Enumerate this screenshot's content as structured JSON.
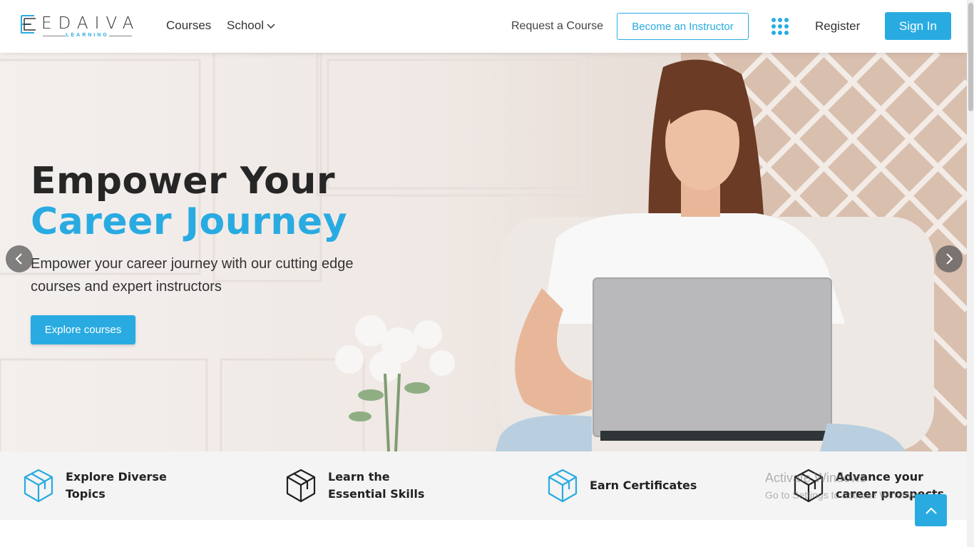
{
  "brand": {
    "name": "EDAIVA",
    "tagline": "LEARNING",
    "accent_color": "#29abe2"
  },
  "nav": {
    "courses": "Courses",
    "school": "School",
    "request_course": "Request a Course",
    "become_instructor": "Become an Instructor",
    "apps_icon": "grid-dots-icon",
    "register": "Register",
    "sign_in": "Sign In"
  },
  "hero": {
    "title_line1": "Empower Your",
    "title_line2": "Career Journey",
    "subtitle": "Empower your career journey with our cutting edge courses and expert instructors",
    "cta": "Explore courses",
    "prev_icon": "chevron-left-icon",
    "next_icon": "chevron-right-icon"
  },
  "features": [
    {
      "label": "Explore Diverse Topics",
      "icon": "cube-icon",
      "icon_color": "#29abe2"
    },
    {
      "label": "Learn the Essential Skills",
      "icon": "cube-icon",
      "icon_color": "#222222"
    },
    {
      "label": "Earn Certificates",
      "icon": "cube-icon",
      "icon_color": "#29abe2"
    },
    {
      "label": "Advance your career prospects",
      "icon": "cube-icon",
      "icon_color": "#222222"
    }
  ],
  "watermark": {
    "line1": "Activate Windows",
    "line2": "Go to Settings to activate Windows."
  },
  "back_to_top_icon": "chevron-up-icon"
}
